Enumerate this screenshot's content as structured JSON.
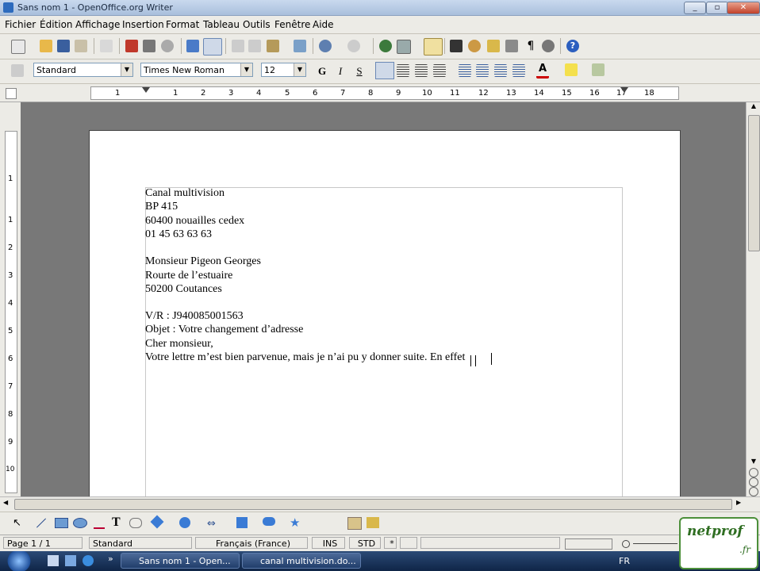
{
  "window": {
    "title": "Sans nom 1 - OpenOffice.org Writer",
    "min": "_",
    "max": "▫",
    "close": "✕"
  },
  "menu": [
    "Fichier",
    "Édition",
    "Affichage",
    "Insertion",
    "Format",
    "Tableau",
    "Outils",
    "Fenêtre",
    "Aide"
  ],
  "formatting": {
    "style": "Standard",
    "font": "Times New Roman",
    "size": "12",
    "bold": "G",
    "italic": "I",
    "underline": "S"
  },
  "ruler_numbers": [
    "1",
    "1",
    "2",
    "3",
    "4",
    "5",
    "6",
    "7",
    "8",
    "9",
    "10",
    "11",
    "12",
    "13",
    "14",
    "15",
    "16",
    "17",
    "18"
  ],
  "vruler_numbers": [
    "1",
    "1",
    "2",
    "3",
    "4",
    "5",
    "6",
    "7",
    "8",
    "9",
    "10"
  ],
  "document": {
    "lines": [
      "Canal multivision",
      "BP 415",
      "60400 nouailles cedex",
      "01 45 63 63 63",
      "",
      "Monsieur Pigeon Georges",
      "Rourte de l’estuaire",
      "50200 Coutances",
      "",
      "V/R : J940085001563",
      "Objet : Votre changement d’adresse",
      "Cher monsieur,",
      "Votre lettre m’est bien parvenue, mais je n’ai pu y donner suite. En effet"
    ]
  },
  "status": {
    "page": "Page 1 / 1",
    "style": "Standard",
    "language": "Français (France)",
    "ins": "INS",
    "std": "STD",
    "star": "*"
  },
  "taskbar": {
    "tasks": [
      "Sans nom 1 - Open...",
      "canal multivision.do..."
    ],
    "lang": "FR"
  },
  "logo": {
    "main": "netprof",
    "sub": ".fr"
  },
  "colors": {
    "workspace": "#787878",
    "toolbar": "#ecebe6",
    "taskbar": "#1a335c"
  }
}
